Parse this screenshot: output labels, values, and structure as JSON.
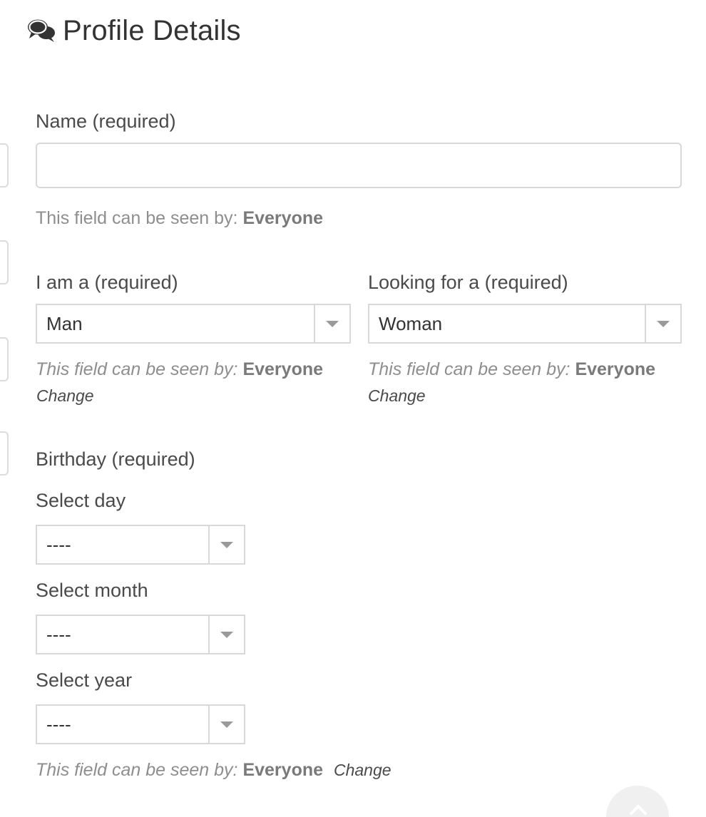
{
  "header": {
    "title": "Profile Details",
    "icon": "comments-icon"
  },
  "fields": {
    "name": {
      "label": "Name (required)",
      "value": "",
      "visibility_prefix": "This field can be seen by:",
      "visibility_level": "Everyone"
    },
    "i_am": {
      "label": "I am a (required)",
      "selected": "Man",
      "visibility_prefix": "This field can be seen by:",
      "visibility_level": "Everyone",
      "change_label": "Change"
    },
    "looking_for": {
      "label": "Looking for a (required)",
      "selected": "Woman",
      "visibility_prefix": "This field can be seen by:",
      "visibility_level": "Everyone",
      "change_label": "Change"
    },
    "birthday": {
      "label": "Birthday (required)",
      "day_label": "Select day",
      "day_selected": "----",
      "month_label": "Select month",
      "month_selected": "----",
      "year_label": "Select year",
      "year_selected": "----",
      "visibility_prefix": "This field can be seen by:",
      "visibility_level": "Everyone",
      "change_label": "Change"
    }
  },
  "colors": {
    "text": "#4a4a4a",
    "muted": "#8e8e8e",
    "border": "#d8d8d8"
  }
}
